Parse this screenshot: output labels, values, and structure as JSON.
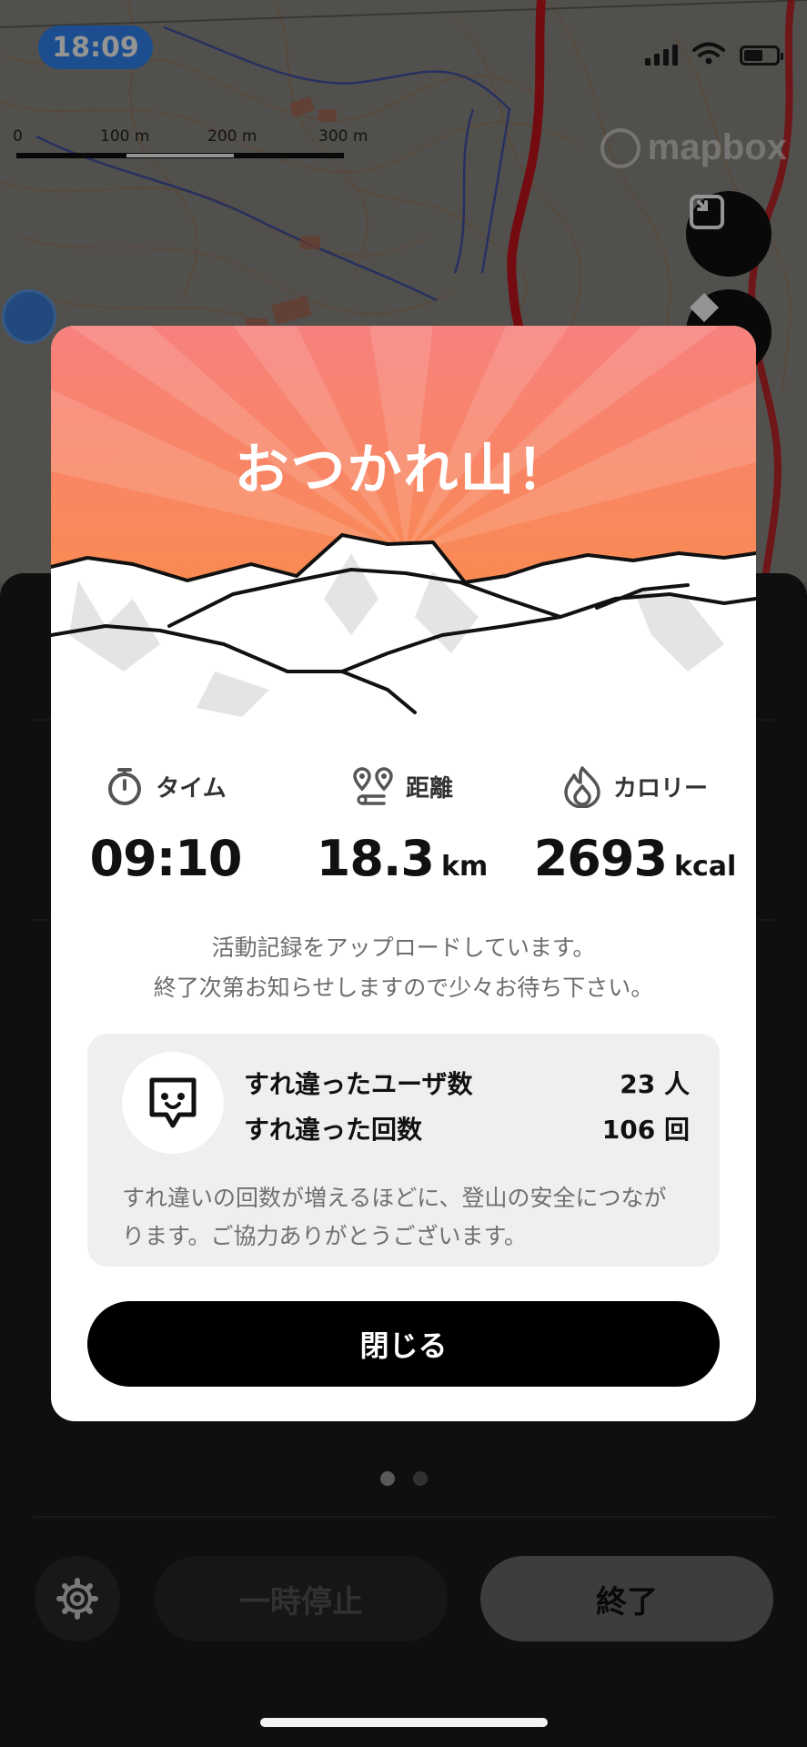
{
  "status_bar": {
    "time": "18:09"
  },
  "map": {
    "scale_labels": [
      "0",
      "100 m",
      "200 m",
      "300 m"
    ],
    "attribution": "mapbox"
  },
  "modal": {
    "title": "おつかれ山！",
    "stats": [
      {
        "icon": "stopwatch-icon",
        "label": "タイム",
        "value": "09:10",
        "unit": ""
      },
      {
        "icon": "route-icon",
        "label": "距離",
        "value": "18.3",
        "unit": "km"
      },
      {
        "icon": "flame-icon",
        "label": "カロリー",
        "value": "2693",
        "unit": "kcal"
      }
    ],
    "upload_message_line1": "活動記録をアップロードしています。",
    "upload_message_line2": "終了次第お知らせしますので少々お待ち下さい。",
    "encounter": {
      "icon": "encounter-face-icon",
      "users_label": "すれ違ったユーザ数",
      "users_value": "23 人",
      "count_label": "すれ違った回数",
      "count_value": "106 回",
      "note": "すれ違いの回数が増えるほどに、登山の安全につながります。ご協力ありがとうございます。"
    },
    "close_label": "閉じる"
  },
  "controls": {
    "pause_label": "一時停止",
    "end_label": "終了",
    "settings_icon": "gear-icon"
  },
  "colors": {
    "header_top": "#f7817d",
    "header_bottom": "#fb8f3a",
    "time_pill": "#2f86f6",
    "route_red": "#c8141c"
  }
}
